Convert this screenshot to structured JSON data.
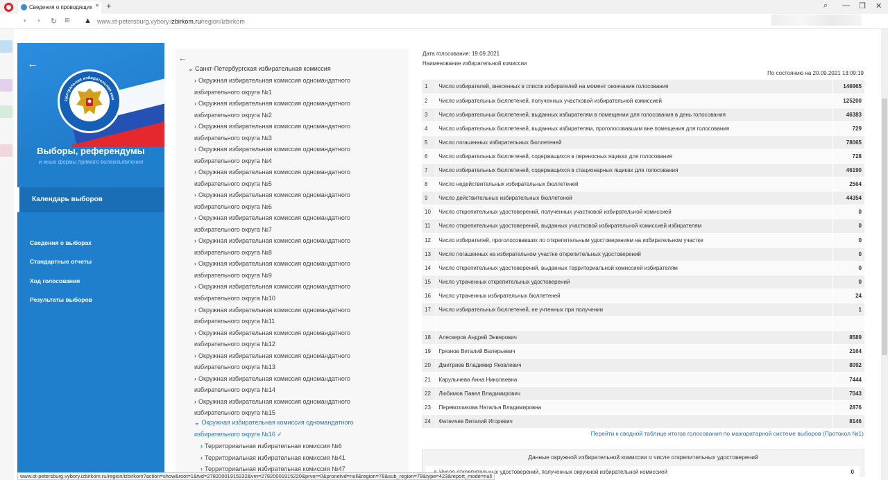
{
  "browser": {
    "tab_title": "Сведения о проводящих",
    "url_prefix": "www.st-petersburg.vybory.",
    "url_domain": "izbirkom.ru",
    "url_path": "/region/izbirkom",
    "status_url": "www.st-petersburg.vybory.izbirkom.ru/region/izbirkom?action=show&root=1&tvd=27820001915232&vrn=27820001915220&prver=0&pronetvd=null&region=78&sub_region=78&type=423&report_mode=null"
  },
  "sidebar": {
    "title": "Выборы, референдумы",
    "subtitle": "и иные формы прямого волеизъявления",
    "active_item": "Календарь выборов",
    "links": [
      "Сведения о выборах",
      "Стандартные отчеты",
      "Ход голосования",
      "Результаты выборов"
    ],
    "logo_text": "Центральная избирательная комиссия Российской Федерации"
  },
  "tree": {
    "root": "Санкт-Петербургская избирательная комиссия",
    "items": [
      {
        "line1": "Окружная избирательная комиссия одномандатного",
        "line2": "избирательного округа №1"
      },
      {
        "line1": "Окружная избирательная комиссия одномандатного",
        "line2": "избирательного округа №2"
      },
      {
        "line1": "Окружная избирательная комиссия одномандатного",
        "line2": "избирательного округа №3"
      },
      {
        "line1": "Окружная избирательная комиссия одномандатного",
        "line2": "избирательного округа №4"
      },
      {
        "line1": "Окружная избирательная комиссия одномандатного",
        "line2": "избирательного округа №5"
      },
      {
        "line1": "Окружная избирательная комиссия одномандатного",
        "line2": "избирательного округа №6"
      },
      {
        "line1": "Окружная избирательная комиссия одномандатного",
        "line2": "избирательного округа №7"
      },
      {
        "line1": "Окружная избирательная комиссия одномандатного",
        "line2": "избирательного округа №8"
      },
      {
        "line1": "Окружная избирательная комиссия одномандатного",
        "line2": "избирательного округа №9"
      },
      {
        "line1": "Окружная избирательная комиссия одномандатного",
        "line2": "избирательного округа №10"
      },
      {
        "line1": "Окружная избирательная комиссия одномандатного",
        "line2": "избирательного округа №11"
      },
      {
        "line1": "Окружная избирательная комиссия одномандатного",
        "line2": "избирательного округа №12"
      },
      {
        "line1": "Окружная избирательная комиссия одномандатного",
        "line2": "избирательного округа №13"
      },
      {
        "line1": "Окружная избирательная комиссия одномандатного",
        "line2": "избирательного округа №14"
      },
      {
        "line1": "Окружная избирательная комиссия одномандатного",
        "line2": "избирательного округа №15"
      }
    ],
    "active": {
      "line1": "Окружная избирательная комиссия одномандатного",
      "line2": "избирательного округа №16"
    },
    "subitems": [
      "Территориальная избирательная комиссия №6",
      "Территориальная избирательная комиссия №41",
      "Территориальная избирательная комиссия №47"
    ]
  },
  "main": {
    "vote_date": "Дата голосования:  19.09.2021",
    "commission_label": "Наименование избирательной комиссии",
    "as_of": "По состоянию на 20.09.2021 13:09:19",
    "rows": [
      {
        "n": "1",
        "label": "Число избирателей, внесенных в список избирателей на момент окончания голосования",
        "value": "146965"
      },
      {
        "n": "2",
        "label": "Число избирательных бюллетеней, полученных участковой избирательной комиссией",
        "value": "125200"
      },
      {
        "n": "3",
        "label": "Число избирательных бюллетеней, выданных избирателям в помещении для голосования в день голосования",
        "value": "46383"
      },
      {
        "n": "4",
        "label": "Число избирательных бюллетеней, выданных избирателям, проголосовавшим вне помещения для голосования",
        "value": "729"
      },
      {
        "n": "5",
        "label": "Число погашенных избирательных бюллетеней",
        "value": "78065"
      },
      {
        "n": "6",
        "label": "Число избирательных бюллетеней, содержащихся в переносных ящиках для голосования",
        "value": "728"
      },
      {
        "n": "7",
        "label": "Число избирательных бюллетеней, содержащихся в стационарных ящиках для голосования",
        "value": "46190"
      },
      {
        "n": "8",
        "label": "Число недействительных избирательных бюллетеней",
        "value": "2564"
      },
      {
        "n": "9",
        "label": "Число действительных избирательных бюллетеней",
        "value": "44354"
      },
      {
        "n": "10",
        "label": "Число открепительных удостоверений, полученных участковой избирательной комиссией",
        "value": "0"
      },
      {
        "n": "11",
        "label": "Число открепительных удостоверений, выданных участковой избирательной комиссией избирателям",
        "value": "0"
      },
      {
        "n": "12",
        "label": "Число избирателей, проголосовавших по открепительным удостоверениям на избирательном участке",
        "value": "0"
      },
      {
        "n": "13",
        "label": "Число погашенных на избирательном участке открепительных удостоверений",
        "value": "0"
      },
      {
        "n": "14",
        "label": "Число открепительных удостоверений, выданных территориальной комиссией избирателям",
        "value": "0"
      },
      {
        "n": "15",
        "label": "Число утраченных открепительных удостоверений",
        "value": "0"
      },
      {
        "n": "16",
        "label": "Число утраченных избирательных бюллетеней",
        "value": "24"
      },
      {
        "n": "17",
        "label": "Число избирательных бюллетеней, не учтенных при получении",
        "value": "1"
      },
      {
        "n": "",
        "label": "",
        "value": ""
      },
      {
        "n": "18",
        "label": "Алескеров Андрей Энверович",
        "value": "8589"
      },
      {
        "n": "19",
        "label": "Грязнов Виталий Валерьевич",
        "value": "2164"
      },
      {
        "n": "20",
        "label": "Дмитриев Владимир Яковлевич",
        "value": "8092"
      },
      {
        "n": "21",
        "label": "Карулычева Анна Николаевна",
        "value": "7444"
      },
      {
        "n": "22",
        "label": "Любимов Павел Владимирович",
        "value": "7043"
      },
      {
        "n": "23",
        "label": "Перевозчикова Наталья Владимировна",
        "value": "2876"
      },
      {
        "n": "24",
        "label": "Фатеичев Виталий Игоревич",
        "value": "8146"
      }
    ],
    "summary_link": "Перейти к сводной таблице итогов голосования по мажоритарной системе выборов (Протокол №1)",
    "box_title": "Данные окружной избирательной комиссии о числе открепительных удостоверений",
    "box_row": {
      "n": "а",
      "label": "Число открепительных удостоверений, полученных окружной избирательной комиссией",
      "value": "0"
    }
  }
}
